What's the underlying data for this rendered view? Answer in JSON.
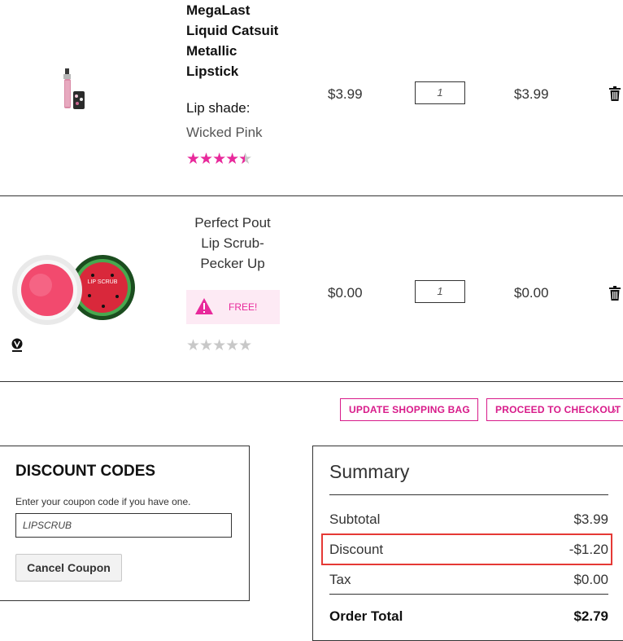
{
  "cart": {
    "items": [
      {
        "name": "MegaLast Liquid Catsuit Metallic Lipstick",
        "attribute_label": "Lip shade:",
        "attribute_value": "Wicked Pink",
        "price": "$3.99",
        "qty": "1",
        "subtotal": "$3.99",
        "rating": 4.5,
        "max_rating": 5
      },
      {
        "name": "Perfect Pout Lip Scrub- Pecker Up",
        "badge": "FREE!",
        "price": "$0.00",
        "qty": "1",
        "subtotal": "$0.00",
        "rating": 0,
        "max_rating": 5
      }
    ],
    "actions": {
      "update_label": "UPDATE SHOPPING BAG",
      "checkout_label": "PROCEED TO CHECKOUT"
    }
  },
  "discount": {
    "title": "DISCOUNT CODES",
    "hint": "Enter your coupon code if you have one.",
    "code": "LIPSCRUB",
    "cancel_label": "Cancel Coupon"
  },
  "summary": {
    "title": "Summary",
    "subtotal_label": "Subtotal",
    "subtotal_value": "$3.99",
    "discount_label": "Discount",
    "discount_value": "-$1.20",
    "tax_label": "Tax",
    "tax_value": "$0.00",
    "total_label": "Order Total",
    "total_value": "$2.79"
  },
  "colors": {
    "accent": "#d81b8a",
    "star": "#e8299b",
    "highlight": "#e53935"
  },
  "icons": {
    "trash": "trash-icon",
    "warning": "warning-icon",
    "chevron": "chevron-right-icon",
    "vegan": "vegan-badge-icon"
  }
}
